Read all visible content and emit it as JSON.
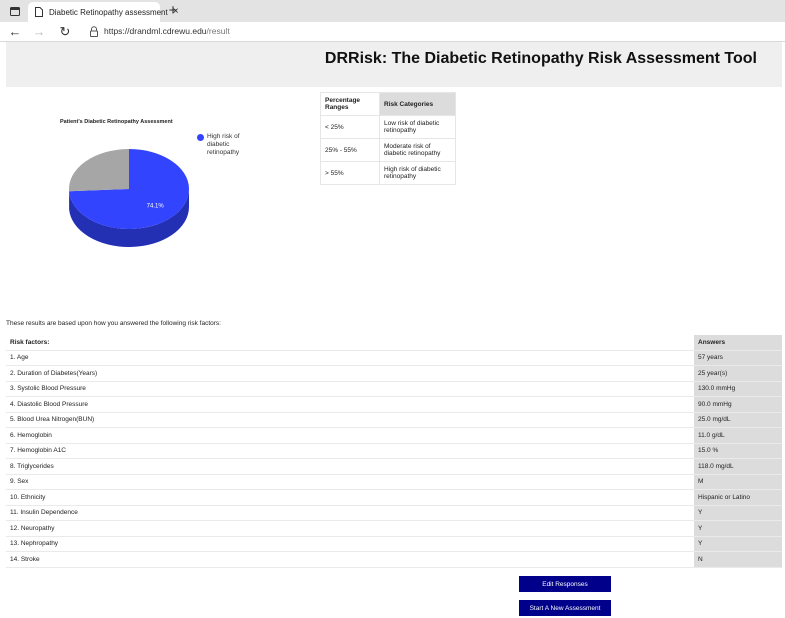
{
  "browser": {
    "tab_title": "Diabetic Retinopathy assessment",
    "tab_close": "×",
    "new_tab": "+",
    "url_host": "https://drandml.cdrewu.edu",
    "url_path": "/result"
  },
  "header": {
    "title": "DRRisk: The Diabetic Retinopathy Risk Assessment Tool"
  },
  "chart": {
    "title": "Patient's Diabetic Retinopathy Assessment",
    "legend_label": "High risk of diabetic retinopathy",
    "slice_label": "74.1%"
  },
  "chart_data": {
    "type": "pie",
    "title": "Patient's Diabetic Retinopathy Assessment",
    "slices": [
      {
        "name": "High risk of diabetic retinopathy",
        "value": 74.1,
        "color": "#3344ff"
      },
      {
        "value": 25.9,
        "color": "#a6a6a6"
      }
    ],
    "legend": [
      "High risk of diabetic retinopathy"
    ],
    "legend_position": "right",
    "style": "3d"
  },
  "risk_table": {
    "headers": [
      "Percentage Ranges",
      "Risk Categories"
    ],
    "rows": [
      [
        "< 25%",
        "Low risk of diabetic retinopathy"
      ],
      [
        "25% - 55%",
        "Moderate risk of diabetic retinopathy"
      ],
      [
        "> 55%",
        "High risk of diabetic retinopathy"
      ]
    ]
  },
  "intro_text": "These results are based upon how you answered the following risk factors:",
  "factors_table": {
    "headers": [
      "Risk factors:",
      "Answers"
    ],
    "rows": [
      [
        "1. Age",
        "57 years"
      ],
      [
        "2. Duration of Diabetes(Years)",
        "25 year(s)"
      ],
      [
        "3. Systolic Blood Pressure",
        "130.0 mmHg"
      ],
      [
        "4. Diastolic Blood Pressure",
        "90.0 mmHg"
      ],
      [
        "5. Blood Urea Nitrogen(BUN)",
        "25.0 mg/dL"
      ],
      [
        "6. Hemoglobin",
        "11.0 g/dL"
      ],
      [
        "7. Hemoglobin A1C",
        "15.0 %"
      ],
      [
        "8. Triglycerides",
        "118.0 mg/dL"
      ],
      [
        "9. Sex",
        "M"
      ],
      [
        "10. Ethnicity",
        "Hispanic or Latino"
      ],
      [
        "11. Insulin Dependence",
        "Y"
      ],
      [
        "12. Neuropathy",
        "Y"
      ],
      [
        "13. Nephropathy",
        "Y"
      ],
      [
        "14. Stroke",
        "N"
      ]
    ]
  },
  "buttons": {
    "edit": "Edit Responses",
    "new": "Start A New Assessment"
  }
}
